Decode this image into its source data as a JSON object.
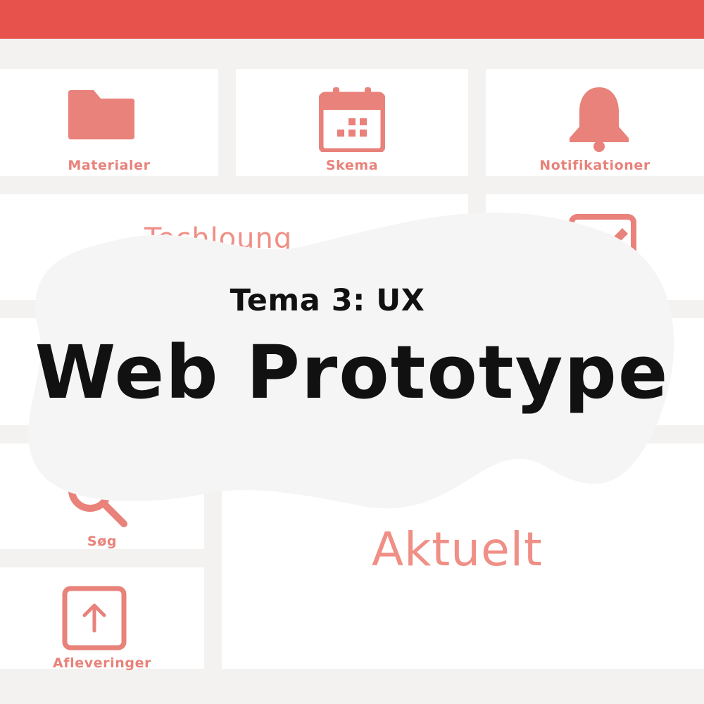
{
  "header": {
    "color": "#e8524c"
  },
  "tiles": {
    "materialer": {
      "label": "Materialer",
      "icon": "folder-icon"
    },
    "skema": {
      "label": "Skema",
      "icon": "calendar-icon"
    },
    "notifikationer": {
      "label": "Notifikationer",
      "icon": "bell-icon"
    },
    "techlounge": {
      "label": "Techloung"
    },
    "sog": {
      "label": "Søg",
      "icon": "search-icon"
    },
    "afleveringer": {
      "label": "Afleveringer",
      "icon": "upload-icon"
    },
    "aktuelt": {
      "label": "Aktuelt"
    }
  },
  "overlay": {
    "subtitle": "Tema 3: UX",
    "title": "Web Prototype"
  },
  "colors": {
    "accent": "#e8827a",
    "background": "#f3f2f0",
    "tile": "#ffffff"
  }
}
